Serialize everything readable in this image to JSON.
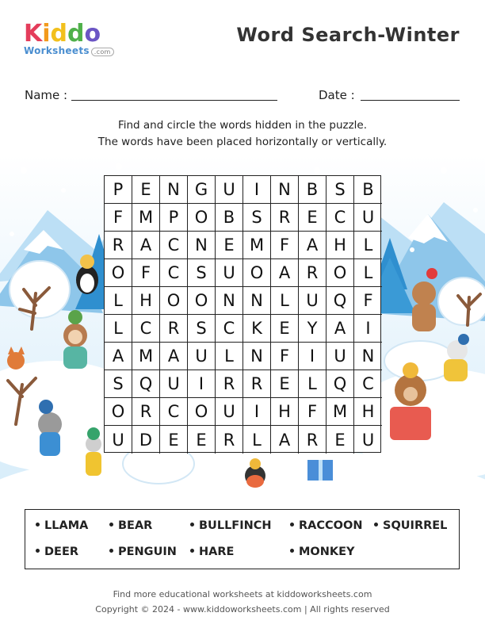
{
  "logo": {
    "brand": "Kiddo",
    "sub": "Worksheets",
    "com": ".com"
  },
  "title": "Word Search-Winter",
  "name_label": "Name :",
  "date_label": "Date :",
  "instructions": [
    "Find and circle the words hidden in the puzzle.",
    "The words have been placed horizontally or vertically."
  ],
  "grid": [
    [
      "P",
      "E",
      "N",
      "G",
      "U",
      "I",
      "N",
      "B",
      "S",
      "B"
    ],
    [
      "F",
      "M",
      "P",
      "O",
      "B",
      "S",
      "R",
      "E",
      "C",
      "U"
    ],
    [
      "R",
      "A",
      "C",
      "N",
      "E",
      "M",
      "F",
      "A",
      "H",
      "L"
    ],
    [
      "O",
      "F",
      "C",
      "S",
      "U",
      "O",
      "A",
      "R",
      "O",
      "L"
    ],
    [
      "L",
      "H",
      "O",
      "O",
      "N",
      "N",
      "L",
      "U",
      "Q",
      "F"
    ],
    [
      "L",
      "C",
      "R",
      "S",
      "C",
      "K",
      "E",
      "Y",
      "A",
      "I"
    ],
    [
      "A",
      "M",
      "A",
      "U",
      "L",
      "N",
      "F",
      "I",
      "U",
      "N"
    ],
    [
      "S",
      "Q",
      "U",
      "I",
      "R",
      "R",
      "E",
      "L",
      "Q",
      "C"
    ],
    [
      "O",
      "R",
      "C",
      "O",
      "U",
      "I",
      "H",
      "F",
      "M",
      "H"
    ],
    [
      "U",
      "D",
      "E",
      "E",
      "R",
      "L",
      "A",
      "R",
      "E",
      "U"
    ]
  ],
  "words": [
    "LLAMA",
    "BEAR",
    "BULLFINCH",
    "RACCOON",
    "SQUIRREL",
    "DEER",
    "PENGUIN",
    "HARE",
    "MONKEY"
  ],
  "footer": [
    "Find more educational worksheets at kiddoworksheets.com",
    "Copyright © 2024 - www.kiddoworksheets.com  |  All rights reserved"
  ],
  "colors": {
    "sky": "#dceefa",
    "snow": "#ffffff",
    "tree": "#2f8fcf",
    "mountain": "#8ec6ea"
  }
}
